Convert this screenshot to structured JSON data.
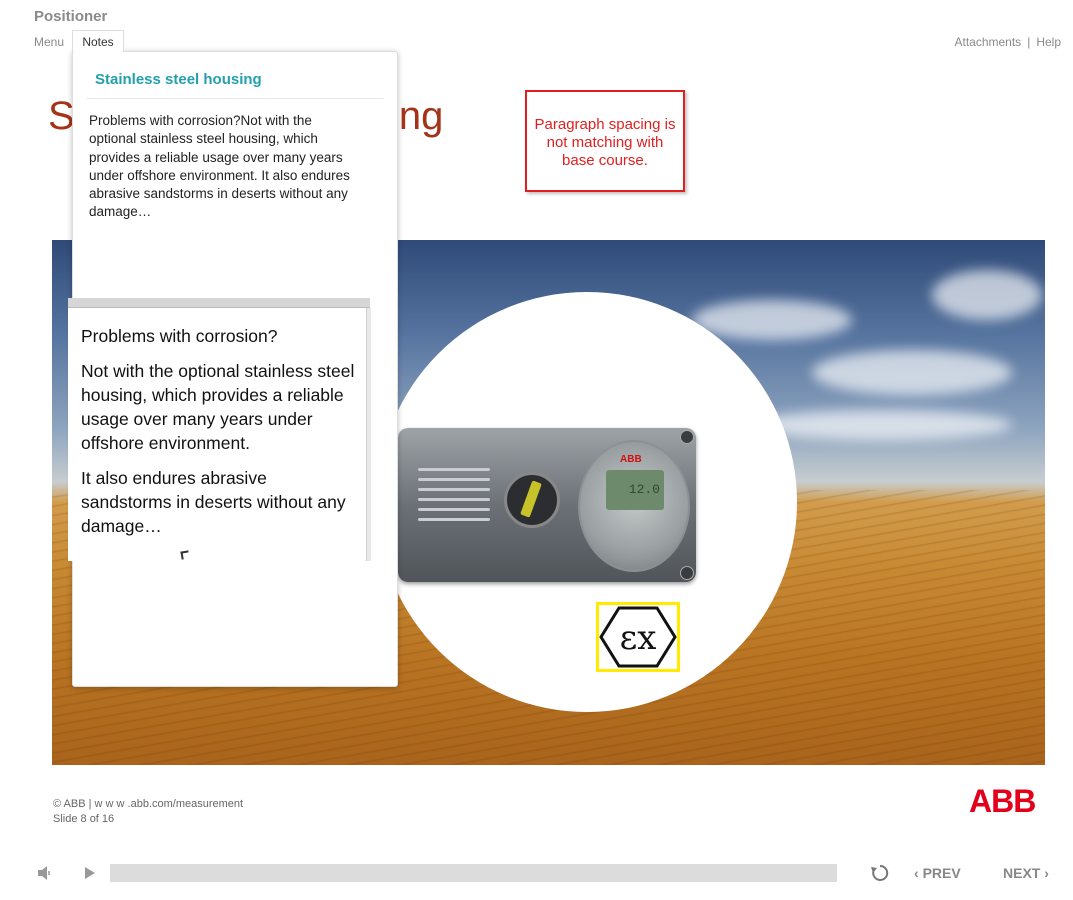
{
  "header": {
    "course_title": "Positioner",
    "menu_label": "Menu",
    "notes_label": "Notes",
    "attachments_label": "Attachments",
    "separator": "|",
    "help_label": "Help"
  },
  "slide": {
    "title_start": "S",
    "title_end": "ing"
  },
  "review_note": {
    "text": "Paragraph spacing is not matching with base course."
  },
  "notes": {
    "heading": "Stainless steel housing",
    "body": "Problems with corrosion?Not with the optional stainless steel housing, which provides a reliable usage over many years under offshore environment. It also endures abrasive sandstorms in deserts without any damage…"
  },
  "text_box": {
    "paragraphs": [
      "Problems with corrosion?",
      "Not with the optional stainless steel housing, which provides a reliable usage over many years under offshore environment.",
      "It also endures abrasive sandstorms in deserts without any damage…"
    ]
  },
  "device": {
    "brand": "ABB",
    "display_value": "12.0"
  },
  "footer": {
    "copyright": "© ABB | w w w .abb.com/measurement",
    "slide_counter": "Slide 8 of 16",
    "logo_text": "ABB"
  },
  "player": {
    "prev_label": "PREV",
    "next_label": "NEXT",
    "progress": 0.0
  },
  "colors": {
    "title_red": "#a33419",
    "notes_heading_teal": "#23a0ad",
    "review_red": "#e02020",
    "abb_red": "#e2001a",
    "ex_border_yellow": "#ffea00"
  },
  "icons": {
    "volume": "speaker-icon",
    "play": "play-icon",
    "replay": "replay-icon",
    "prev": "chevron-left-icon",
    "next": "chevron-right-icon",
    "ex": "ex-atex-icon"
  }
}
